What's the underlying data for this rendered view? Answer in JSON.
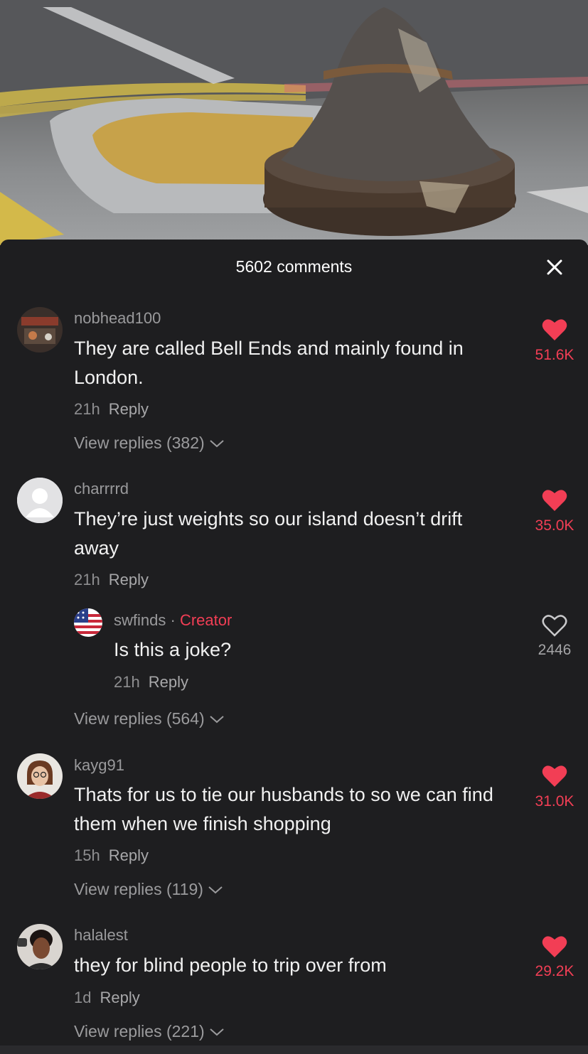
{
  "header": {
    "comment_count": "5602 comments"
  },
  "comments": [
    {
      "user": "nobhead100",
      "text": "They are called Bell Ends and mainly found in London.",
      "time": "21h",
      "reply": "Reply",
      "likes": "51.6K",
      "liked": true,
      "view_replies": "View replies (382)"
    },
    {
      "user": "charrrrd",
      "text": "They’re just weights so our island doesn’t drift away",
      "time": "21h",
      "reply": "Reply",
      "likes": "35.0K",
      "liked": true,
      "view_replies": "View replies (564)"
    },
    {
      "user": "kayg91",
      "text": "Thats for us to tie our husbands to so we can find them when we finish shopping",
      "time": "15h",
      "reply": "Reply",
      "likes": "31.0K",
      "liked": true,
      "view_replies": "View replies (119)"
    },
    {
      "user": "halalest",
      "text": "they for blind people to trip over from",
      "time": "1d",
      "reply": "Reply",
      "likes": "29.2K",
      "liked": true,
      "view_replies": "View replies (221)"
    }
  ],
  "creator_reply": {
    "user": "swfinds",
    "separator": "·",
    "badge": "Creator",
    "text": "Is this a joke?",
    "time": "21h",
    "reply": "Reply",
    "likes": "2446",
    "liked": false
  },
  "colors": {
    "accent": "#f23e55",
    "background": "#1e1e20"
  }
}
